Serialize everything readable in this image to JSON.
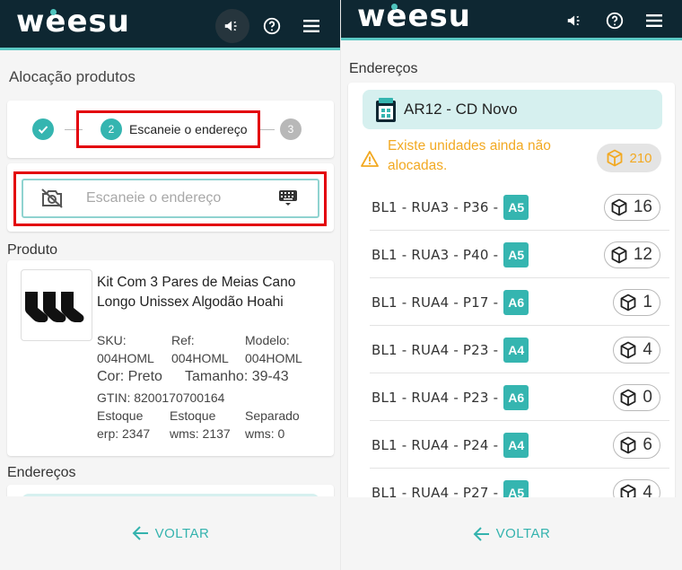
{
  "app": {
    "logo": "weesu"
  },
  "left": {
    "page_title": "Alocação produtos",
    "stepper": {
      "step2_num": "2",
      "step2_label": "Escaneie o endereço",
      "step3_num": "3"
    },
    "scan": {
      "placeholder": "Escaneie o endereço"
    },
    "product_section": "Produto",
    "product": {
      "name": "Kit Com 3 Pares de Meias Cano Longo Unissex Algodão Hoahi",
      "sku_label": "SKU:",
      "sku": "004HOML",
      "ref_label": "Ref:",
      "ref": "004HOML",
      "model_label": "Modelo:",
      "model": "004HOML",
      "color": "Cor: Preto",
      "size": "Tamanho: 39-43",
      "gtin": "GTIN: 8200170700164",
      "stock_erp_label": "Estoque",
      "stock_erp": "erp: 2347",
      "stock_wms_label": "Estoque",
      "stock_wms": "wms: 2137",
      "separated_label": "Separado",
      "separated": "wms: 0"
    },
    "addresses_section": "Endereços",
    "back": "VOLTAR"
  },
  "right": {
    "addresses_section": "Endereços",
    "warehouse": "AR12 - CD Novo",
    "warning": "Existe unidades ainda não alocadas.",
    "unallocated": "210",
    "addresses": [
      {
        "label": "BL1 - RUA3 - P36 -",
        "zone": "A5",
        "qty": "16"
      },
      {
        "label": "BL1 - RUA3 - P40 -",
        "zone": "A5",
        "qty": "12"
      },
      {
        "label": "BL1 - RUA4 - P17 -",
        "zone": "A6",
        "qty": "1"
      },
      {
        "label": "BL1 - RUA4 - P23 -",
        "zone": "A4",
        "qty": "4"
      },
      {
        "label": "BL1 - RUA4 - P23 -",
        "zone": "A6",
        "qty": "0"
      },
      {
        "label": "BL1 - RUA4 - P24 -",
        "zone": "A4",
        "qty": "6"
      },
      {
        "label": "BL1 - RUA4 - P27 -",
        "zone": "A5",
        "qty": "4"
      }
    ],
    "back": "VOLTAR"
  },
  "colors": {
    "header": "#0e2732",
    "accent": "#35b5b0",
    "highlight": "#e3000b",
    "warning": "#f2a922"
  }
}
